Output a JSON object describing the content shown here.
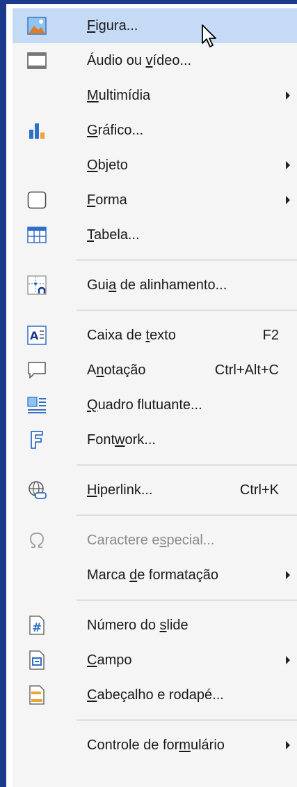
{
  "menu": {
    "items": [
      {
        "pre": "",
        "u": "F",
        "post": "igura...",
        "shortcut": "",
        "submenu": false
      },
      {
        "pre": "Áudio ou ",
        "u": "v",
        "post": "ídeo...",
        "shortcut": "",
        "submenu": false
      },
      {
        "pre": "",
        "u": "M",
        "post": "ultimídia",
        "shortcut": "",
        "submenu": true
      },
      {
        "pre": "",
        "u": "G",
        "post": "ráfico...",
        "shortcut": "",
        "submenu": false
      },
      {
        "pre": "",
        "u": "O",
        "post": "bjeto",
        "shortcut": "",
        "submenu": true
      },
      {
        "pre": "",
        "u": "F",
        "post": "orma",
        "shortcut": "",
        "submenu": true
      },
      {
        "pre": "",
        "u": "T",
        "post": "abela...",
        "shortcut": "",
        "submenu": false
      },
      {
        "pre": "Gui",
        "u": "a",
        "post": " de alinhamento...",
        "shortcut": "",
        "submenu": false
      },
      {
        "pre": "Caixa de ",
        "u": "t",
        "post": "exto",
        "shortcut": "F2",
        "submenu": false
      },
      {
        "pre": "A",
        "u": "n",
        "post": "otação",
        "shortcut": "Ctrl+Alt+C",
        "submenu": false
      },
      {
        "pre": "",
        "u": "Q",
        "post": "uadro flutuante...",
        "shortcut": "",
        "submenu": false
      },
      {
        "pre": "Font",
        "u": "w",
        "post": "ork...",
        "shortcut": "",
        "submenu": false
      },
      {
        "pre": "",
        "u": "H",
        "post": "iperlink...",
        "shortcut": "Ctrl+K",
        "submenu": false
      },
      {
        "pre": "Caractere e",
        "u": "s",
        "post": "pecial...",
        "shortcut": "",
        "submenu": false
      },
      {
        "pre": "Marca ",
        "u": "d",
        "post": "e formatação",
        "shortcut": "",
        "submenu": true
      },
      {
        "pre": "Número do ",
        "u": "s",
        "post": "lide",
        "shortcut": "",
        "submenu": false
      },
      {
        "pre": "",
        "u": "C",
        "post": "ampo",
        "shortcut": "",
        "submenu": true
      },
      {
        "pre": "",
        "u": "C",
        "post": "abeçalho e rodapé...",
        "shortcut": "",
        "submenu": false
      },
      {
        "pre": "Controle de for",
        "u": "m",
        "post": "ulário",
        "shortcut": "",
        "submenu": true
      }
    ],
    "icons": {
      "0": "image-icon",
      "1": "video-icon",
      "3": "chart-icon",
      "5": "shape-icon",
      "6": "table-icon",
      "7": "snap-guide-icon",
      "8": "text-box-icon",
      "9": "comment-icon",
      "10": "floating-frame-icon",
      "11": "fontwork-icon",
      "12": "hyperlink-icon",
      "13": "omega-icon",
      "15": "slide-number-icon",
      "16": "field-icon",
      "17": "header-footer-icon"
    },
    "highlighted_index": 0,
    "disabled_index": 13,
    "colors": {
      "frame": "#1a3a8c",
      "highlight": "#c5daf5",
      "background": "#f5f5f5",
      "accent_blue": "#2f6fc7"
    }
  }
}
